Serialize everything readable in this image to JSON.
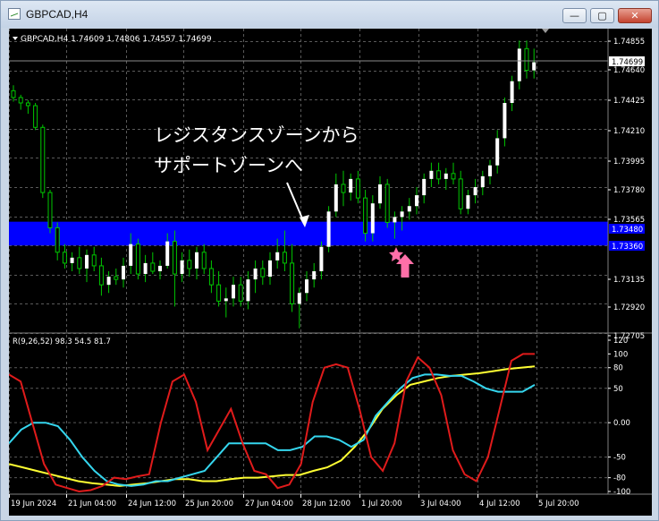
{
  "window": {
    "title": "GBPCAD,H4",
    "min_glyph": "—",
    "max_glyph": "▢",
    "close_glyph": "✕"
  },
  "colors": {
    "background": "#000000",
    "grid": "#5a5a5a",
    "bull_candle": "#ffffff",
    "bear_candle": "#000000",
    "wick": "#00c800",
    "zone": "#0000ff",
    "arrow": "#ff6fa8",
    "rci_short": "#e01b1b",
    "rci_mid": "#35d6ee",
    "rci_long": "#ffff33",
    "text": "#ffffff"
  },
  "price_panel": {
    "info": "GBPCAD,H4  1.74609 1.74806 1.74557 1.74699",
    "annotation_line1": "レジスタンスゾーンから",
    "annotation_line2": "サポートゾーンへ",
    "price_ticks": [
      "1.74855",
      "1.74640",
      "1.74425",
      "1.74210",
      "1.73995",
      "1.73780",
      "1.73565",
      "1.73135",
      "1.72920",
      "1.72705"
    ],
    "current_price": "1.74699",
    "zone_top_label": "1.73480",
    "zone_bottom_label": "1.73360",
    "zone": {
      "top": 1.7348,
      "bottom": 1.7336
    },
    "current_price_value": 1.74699,
    "marker_icon": "pink-star-icon",
    "arrow_icon": "pink-up-arrow-icon"
  },
  "rci_panel": {
    "label": "R(9,26,52) 98.3 54.5 81.7",
    "ticks": [
      "120",
      "100",
      "80",
      "50",
      "0.00",
      "-50",
      "-80",
      "-100"
    ]
  },
  "time_axis": {
    "labels": [
      "19 Jun 2024",
      "21 Jun 04:00",
      "24 Jun 12:00",
      "25 Jun 20:00",
      "27 Jun 04:00",
      "28 Jun 12:00",
      "1 Jul 20:00",
      "3 Jul 04:00",
      "4 Jul 12:00",
      "5 Jul 20:00"
    ]
  },
  "chart_data": {
    "type": "candlestick",
    "symbol": "GBPCAD",
    "timeframe": "H4",
    "ylim": [
      1.72705,
      1.74855
    ],
    "zone": [
      1.7336,
      1.7348
    ],
    "candles": [
      [
        1.7449,
        1.7453,
        1.7441,
        1.7444
      ],
      [
        1.7444,
        1.7446,
        1.7435,
        1.744
      ],
      [
        1.744,
        1.7442,
        1.7432,
        1.7438
      ],
      [
        1.7438,
        1.744,
        1.742,
        1.7422
      ],
      [
        1.7422,
        1.7424,
        1.737,
        1.7374
      ],
      [
        1.7374,
        1.7376,
        1.7344,
        1.7348
      ],
      [
        1.7348,
        1.7352,
        1.7324,
        1.733
      ],
      [
        1.733,
        1.7336,
        1.7318,
        1.7322
      ],
      [
        1.7322,
        1.733,
        1.7316,
        1.7326
      ],
      [
        1.7326,
        1.7334,
        1.7314,
        1.7318
      ],
      [
        1.7318,
        1.7332,
        1.7308,
        1.7328
      ],
      [
        1.7328,
        1.7334,
        1.7316,
        1.732
      ],
      [
        1.732,
        1.7326,
        1.7298,
        1.7306
      ],
      [
        1.7306,
        1.7316,
        1.73,
        1.7312
      ],
      [
        1.7312,
        1.7318,
        1.7306,
        1.731
      ],
      [
        1.731,
        1.7326,
        1.7304,
        1.732
      ],
      [
        1.732,
        1.7344,
        1.7314,
        1.7336
      ],
      [
        1.7336,
        1.734,
        1.731,
        1.7314
      ],
      [
        1.7314,
        1.7328,
        1.7308,
        1.7322
      ],
      [
        1.7322,
        1.733,
        1.7314,
        1.7316
      ],
      [
        1.7316,
        1.7324,
        1.731,
        1.732
      ],
      [
        1.732,
        1.7344,
        1.7318,
        1.7338
      ],
      [
        1.7338,
        1.7346,
        1.729,
        1.7314
      ],
      [
        1.7314,
        1.733,
        1.7308,
        1.7324
      ],
      [
        1.7324,
        1.7332,
        1.7312,
        1.7318
      ],
      [
        1.7318,
        1.7334,
        1.731,
        1.733
      ],
      [
        1.733,
        1.7336,
        1.7314,
        1.7318
      ],
      [
        1.7318,
        1.7324,
        1.73,
        1.7306
      ],
      [
        1.7306,
        1.7316,
        1.729,
        1.7294
      ],
      [
        1.7294,
        1.7304,
        1.7282,
        1.7296
      ],
      [
        1.7296,
        1.7312,
        1.729,
        1.7306
      ],
      [
        1.7306,
        1.7312,
        1.729,
        1.7294
      ],
      [
        1.7294,
        1.7316,
        1.7288,
        1.731
      ],
      [
        1.731,
        1.7324,
        1.73,
        1.7318
      ],
      [
        1.7318,
        1.7324,
        1.7306,
        1.7312
      ],
      [
        1.7312,
        1.733,
        1.7306,
        1.7324
      ],
      [
        1.7324,
        1.734,
        1.7318,
        1.733
      ],
      [
        1.733,
        1.7346,
        1.7316,
        1.7322
      ],
      [
        1.7322,
        1.7336,
        1.7286,
        1.7292
      ],
      [
        1.7292,
        1.7304,
        1.7274,
        1.73
      ],
      [
        1.73,
        1.7316,
        1.7294,
        1.731
      ],
      [
        1.731,
        1.7322,
        1.7304,
        1.7316
      ],
      [
        1.7316,
        1.7338,
        1.731,
        1.7334
      ],
      [
        1.7334,
        1.7364,
        1.733,
        1.736
      ],
      [
        1.736,
        1.7388,
        1.7356,
        1.738
      ],
      [
        1.738,
        1.739,
        1.7364,
        1.7374
      ],
      [
        1.7374,
        1.7388,
        1.7368,
        1.7384
      ],
      [
        1.7384,
        1.739,
        1.7366,
        1.737
      ],
      [
        1.737,
        1.7376,
        1.7338,
        1.7344
      ],
      [
        1.7344,
        1.7372,
        1.7338,
        1.7366
      ],
      [
        1.7366,
        1.7386,
        1.7362,
        1.738
      ],
      [
        1.738,
        1.7384,
        1.7348,
        1.7352
      ],
      [
        1.7352,
        1.736,
        1.734,
        1.7356
      ],
      [
        1.7356,
        1.7364,
        1.7346,
        1.736
      ],
      [
        1.736,
        1.737,
        1.7354,
        1.7364
      ],
      [
        1.7364,
        1.7378,
        1.7358,
        1.7372
      ],
      [
        1.7372,
        1.7388,
        1.7366,
        1.7384
      ],
      [
        1.7384,
        1.7396,
        1.7378,
        1.739
      ],
      [
        1.739,
        1.7396,
        1.738,
        1.7384
      ],
      [
        1.7384,
        1.7392,
        1.7376,
        1.7388
      ],
      [
        1.7388,
        1.7396,
        1.738,
        1.7384
      ],
      [
        1.7384,
        1.739,
        1.7358,
        1.7362
      ],
      [
        1.7362,
        1.7376,
        1.7358,
        1.7372
      ],
      [
        1.7372,
        1.7384,
        1.7366,
        1.7378
      ],
      [
        1.7378,
        1.739,
        1.7372,
        1.7386
      ],
      [
        1.7386,
        1.7398,
        1.738,
        1.7394
      ],
      [
        1.7394,
        1.742,
        1.7388,
        1.7414
      ],
      [
        1.7414,
        1.7444,
        1.7408,
        1.744
      ],
      [
        1.744,
        1.746,
        1.7434,
        1.7456
      ],
      [
        1.7456,
        1.7486,
        1.745,
        1.748
      ],
      [
        1.748,
        1.7486,
        1.7458,
        1.7464
      ],
      [
        1.7464,
        1.748,
        1.7458,
        1.747
      ]
    ]
  }
}
